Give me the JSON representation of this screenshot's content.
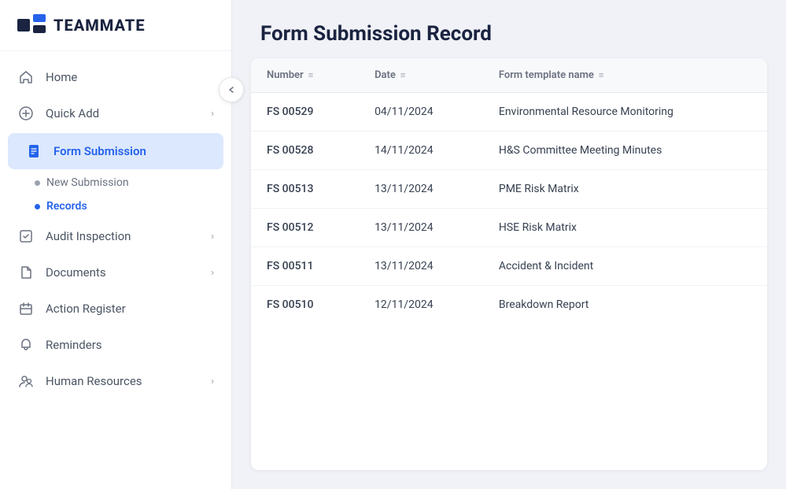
{
  "app": {
    "name": "TEAMMATE"
  },
  "sidebar": {
    "items": [
      {
        "id": "home",
        "label": "Home",
        "icon": "home",
        "active": false,
        "hasChevron": false
      },
      {
        "id": "quick-add",
        "label": "Quick Add",
        "icon": "quick-add",
        "active": false,
        "hasChevron": true
      },
      {
        "id": "form-submission",
        "label": "Form Submission",
        "icon": "form",
        "active": true,
        "hasChevron": false
      },
      {
        "id": "audit-inspection",
        "label": "Audit Inspection",
        "icon": "audit",
        "active": false,
        "hasChevron": true
      },
      {
        "id": "documents",
        "label": "Documents",
        "icon": "documents",
        "active": false,
        "hasChevron": true
      },
      {
        "id": "action-register",
        "label": "Action Register",
        "icon": "action",
        "active": false,
        "hasChevron": false
      },
      {
        "id": "reminders",
        "label": "Reminders",
        "icon": "reminders",
        "active": false,
        "hasChevron": false
      },
      {
        "id": "human-resources",
        "label": "Human Resources",
        "icon": "hr",
        "active": false,
        "hasChevron": true
      }
    ],
    "sub_items": [
      {
        "id": "new-submission",
        "label": "New Submission",
        "active": false
      },
      {
        "id": "records",
        "label": "Records",
        "active": true
      }
    ]
  },
  "page": {
    "title": "Form Submission Record"
  },
  "table": {
    "columns": [
      {
        "id": "number",
        "label": "Number"
      },
      {
        "id": "date",
        "label": "Date"
      },
      {
        "id": "form_template_name",
        "label": "Form template name"
      }
    ],
    "rows": [
      {
        "number": "FS 00529",
        "date": "04/11/2024",
        "form_template_name": "Environmental Resource Monitoring"
      },
      {
        "number": "FS 00528",
        "date": "14/11/2024",
        "form_template_name": "H&S Committee Meeting Minutes"
      },
      {
        "number": "FS 00513",
        "date": "13/11/2024",
        "form_template_name": "PME Risk Matrix"
      },
      {
        "number": "FS 00512",
        "date": "13/11/2024",
        "form_template_name": "HSE Risk Matrix"
      },
      {
        "number": "FS 00511",
        "date": "13/11/2024",
        "form_template_name": "Accident & Incident"
      },
      {
        "number": "FS 00510",
        "date": "12/11/2024",
        "form_template_name": "Breakdown Report"
      }
    ]
  }
}
